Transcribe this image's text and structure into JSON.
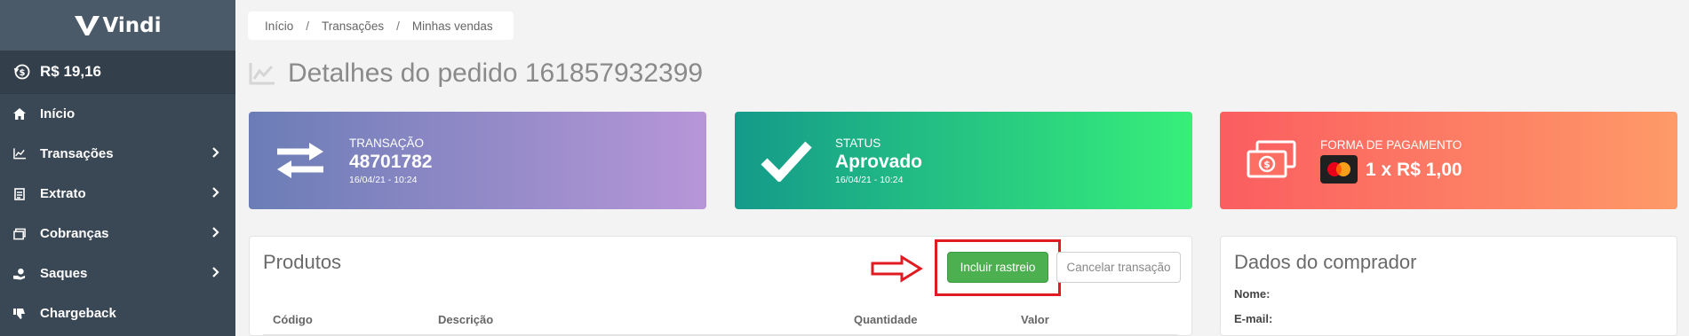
{
  "sidebar": {
    "brand": "Vindi",
    "balance": "R$ 19,16",
    "items": [
      {
        "label": "Início",
        "icon": "home-icon"
      },
      {
        "label": "Transações",
        "icon": "line-chart-icon"
      },
      {
        "label": "Extrato",
        "icon": "document-icon"
      },
      {
        "label": "Cobranças",
        "icon": "invoices-icon"
      },
      {
        "label": "Saques",
        "icon": "hand-coin-icon"
      },
      {
        "label": "Chargeback",
        "icon": "thumbs-down-icon"
      }
    ]
  },
  "breadcrumb": {
    "items": [
      "Início",
      "Transações",
      "Minhas vendas"
    ],
    "separator": "/"
  },
  "page": {
    "title": "Detalhes do pedido 161857932399"
  },
  "cards": {
    "transacao": {
      "label": "TRANSAÇÃO",
      "value": "48701782",
      "date": "16/04/21 - 10:24"
    },
    "status": {
      "label": "STATUS",
      "value": "Aprovado",
      "date": "16/04/21 - 10:24"
    },
    "pagamento": {
      "label": "FORMA DE PAGAMENTO",
      "value": "1 x R$ 1,00",
      "card_brand": "mastercard"
    }
  },
  "produtos": {
    "title": "Produtos",
    "include_tracking_label": "Incluir rastreio",
    "cancel_label": "Cancelar transação",
    "columns": [
      "Código",
      "Descrição",
      "Quantidade",
      "Valor"
    ]
  },
  "comprador": {
    "title": "Dados do comprador",
    "fields": [
      {
        "label": "Nome:",
        "value": ""
      },
      {
        "label": "E-mail:",
        "value": ""
      }
    ]
  },
  "colors": {
    "sidebar_bg": "#3a4754",
    "green_button": "#4caf50",
    "annotation_red": "#e21b22"
  }
}
